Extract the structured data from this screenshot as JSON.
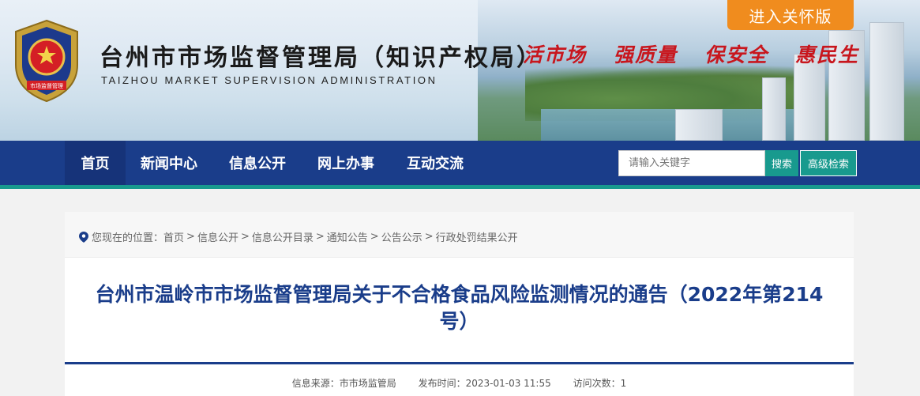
{
  "header": {
    "site_title": "台州市市场监督管理局（知识产权局）",
    "site_subtitle": "TAIZHOU MARKET SUPERVISION ADMINISTRATION",
    "emblem_text": "市场监督管理",
    "slogans": [
      "活市场",
      "强质量",
      "保安全",
      "惠民生"
    ],
    "care_mode_label": "进入关怀版"
  },
  "nav": {
    "items": [
      {
        "label": "首页"
      },
      {
        "label": "新闻中心"
      },
      {
        "label": "信息公开"
      },
      {
        "label": "网上办事"
      },
      {
        "label": "互动交流"
      }
    ],
    "search_placeholder": "请输入关键字",
    "search_label": "搜索",
    "advanced_search_label": "高级检索"
  },
  "breadcrumb": {
    "prefix": "您现在的位置：",
    "items": [
      "首页",
      "信息公开",
      "信息公开目录",
      "通知公告",
      "公告公示",
      "行政处罚结果公开"
    ]
  },
  "article": {
    "title": "台州市温岭市市场监督管理局关于不合格食品风险监测情况的通告（2022年第214号）",
    "source_label": "信息来源：市市场监管局",
    "publish_label": "发布时间：2023-01-03 11:55",
    "visits_label": "访问次数：1"
  },
  "colors": {
    "nav_bg": "#1a3d8a",
    "accent_teal": "#189a8e",
    "slogan_red": "#c8161d",
    "care_orange": "#f08c1e"
  }
}
